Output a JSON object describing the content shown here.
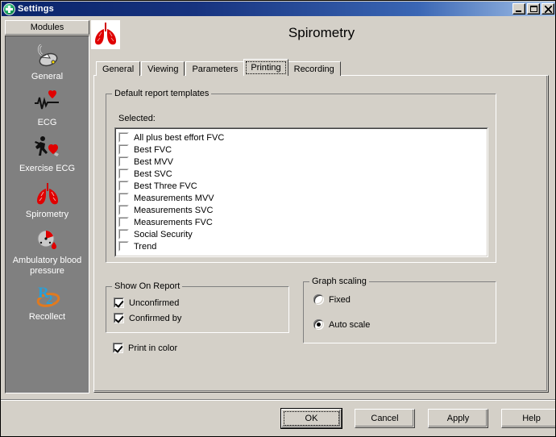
{
  "window": {
    "title": "Settings",
    "icon": "medical-cross-disc-icon",
    "minimize_label": "_",
    "maximize_label": "□",
    "close_label": "×"
  },
  "sidebar": {
    "header": "Modules",
    "items": [
      {
        "label": "General",
        "icon": "mouse-icon"
      },
      {
        "label": "ECG",
        "icon": "ecg-heart-icon"
      },
      {
        "label": "Exercise ECG",
        "icon": "runner-heart-icon"
      },
      {
        "label": "Spirometry",
        "icon": "lungs-icon"
      },
      {
        "label": "Ambulatory blood pressure",
        "icon": "blood-pressure-gauge-icon"
      },
      {
        "label": "Recollect",
        "icon": "recollect-r2-icon"
      }
    ],
    "selected": "Spirometry"
  },
  "header": {
    "title": "Spirometry",
    "icon": "lungs-icon"
  },
  "tabs": [
    {
      "label": "General",
      "active": false
    },
    {
      "label": "Viewing",
      "active": false
    },
    {
      "label": "Parameters",
      "active": false
    },
    {
      "label": "Printing",
      "active": true
    },
    {
      "label": "Recording",
      "active": false
    }
  ],
  "printing": {
    "templates_group": {
      "title": "Default report templates",
      "selected_label": "Selected:",
      "items": [
        {
          "label": "All plus best effort FVC",
          "checked": false
        },
        {
          "label": "Best FVC",
          "checked": false
        },
        {
          "label": "Best MVV",
          "checked": false
        },
        {
          "label": "Best SVC",
          "checked": false
        },
        {
          "label": "Best Three FVC",
          "checked": false
        },
        {
          "label": "Measurements MVV",
          "checked": false
        },
        {
          "label": "Measurements SVC",
          "checked": false
        },
        {
          "label": "Measurements FVC",
          "checked": false
        },
        {
          "label": "Social Security",
          "checked": false
        },
        {
          "label": "Trend",
          "checked": false
        }
      ]
    },
    "show_on_report": {
      "title": "Show On Report",
      "options": [
        {
          "label": "Unconfirmed",
          "checked": true
        },
        {
          "label": "Confirmed by",
          "checked": true
        }
      ]
    },
    "print_in_color": {
      "label": "Print in color",
      "checked": true
    },
    "graph_scaling": {
      "title": "Graph scaling",
      "options": [
        {
          "label": "Fixed",
          "selected": false
        },
        {
          "label": "Auto scale",
          "selected": true
        }
      ]
    }
  },
  "footer": {
    "buttons": [
      {
        "label": "OK",
        "default": true
      },
      {
        "label": "Cancel",
        "default": false
      },
      {
        "label": "Apply",
        "default": false
      },
      {
        "label": "Help",
        "default": false
      }
    ]
  },
  "colors": {
    "window_face": "#d4d0c8",
    "sidebar_panel": "#808080",
    "titlebar_start": "#0a246a",
    "titlebar_end": "#a6c4ea",
    "listbox_bg": "#ffffff",
    "accent_red": "#e00000",
    "accent_blue": "#2a9fd6",
    "accent_orange": "#e07a1f"
  }
}
